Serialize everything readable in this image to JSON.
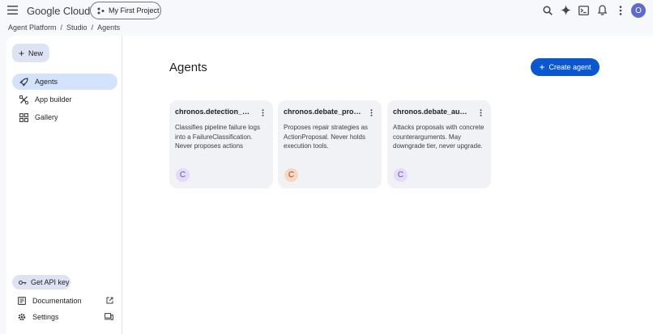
{
  "header": {
    "brand": "Google Cloud",
    "project": "My First Project",
    "avatar_letter": "O",
    "icons": [
      "menu-icon",
      "search-icon",
      "gemini-sparkle-icon",
      "terminal-icon",
      "bell-icon",
      "more-vert-icon"
    ]
  },
  "breadcrumb": {
    "items": [
      "Agent Platform",
      "Studio",
      "Agents"
    ],
    "separator": "/"
  },
  "sidebar": {
    "new_label": "New",
    "items": [
      {
        "label": "Agents",
        "icon": "rocket-icon",
        "active": true
      },
      {
        "label": "App builder",
        "icon": "app-builder-icon",
        "active": false
      },
      {
        "label": "Gallery",
        "icon": "grid-icon",
        "active": false
      }
    ],
    "api_key_label": "Get API key",
    "footer": [
      {
        "label": "Documentation",
        "icon": "docs-icon",
        "trail_icon": "open-in-new-icon"
      },
      {
        "label": "Settings",
        "icon": "gear-icon",
        "trail_icon": "devices-icon"
      }
    ]
  },
  "main": {
    "title": "Agents",
    "create_label": "Create agent",
    "cards": [
      {
        "title": "chronos.detection_ag...",
        "description": "Classifies pipeline failure logs into a FailureClassification. Never proposes actions",
        "avatar": "C",
        "avatar_bg": "#e5dcfb",
        "avatar_fg": "#6750a4"
      },
      {
        "title": "chronos.debate_prop...",
        "description": "Proposes repair strategies as ActionProposal. Never holds execution tools.",
        "avatar": "C",
        "avatar_bg": "#fbd7c2",
        "avatar_fg": "#8a4b2a"
      },
      {
        "title": "chronos.debate_audit...",
        "description": "Attacks proposals with concrete counterarguments. May downgrade tier, never upgrade.",
        "avatar": "C",
        "avatar_bg": "#e5dcfb",
        "avatar_fg": "#6750a4"
      }
    ]
  },
  "colors": {
    "accent": "#0b57d0",
    "active_nav": "#d3e3fd",
    "tonal_button": "#dde3f3",
    "card_bg": "#f0f2f6",
    "page_bg": "#f7f8fc"
  }
}
